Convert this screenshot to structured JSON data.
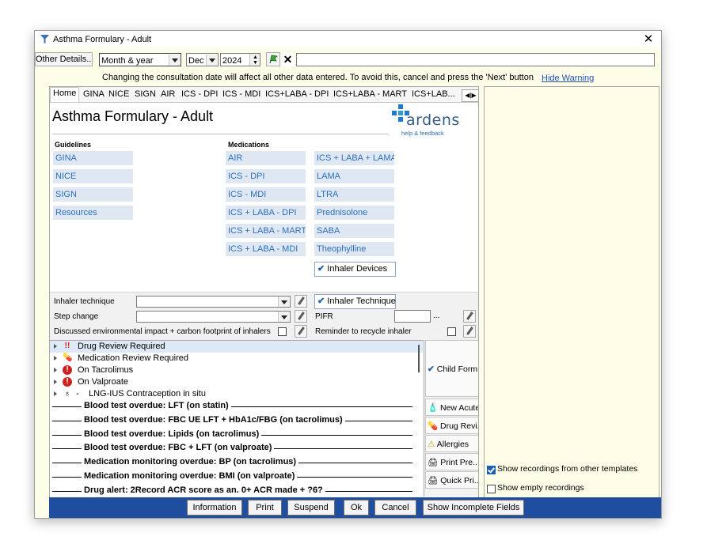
{
  "window": {
    "title": "Asthma Formulary - Adult",
    "close_icon": "close-icon"
  },
  "toolbar": {
    "other_details_label": "Other Details...",
    "period_selected": "Month & year",
    "month_selected": "Dec",
    "year_value": "2024",
    "accept_icon": "green-flag-icon",
    "clear_icon": "x-icon",
    "text_value": ""
  },
  "warning": {
    "text": "Changing the consultation date will affect all other data entered. To avoid this, cancel and press the 'Next' button",
    "hide_label": "Hide Warning"
  },
  "tabs": [
    "Home",
    "GINA",
    "NICE",
    "SIGN",
    "AIR",
    "ICS - DPI",
    "ICS - MDI",
    "ICS+LABA - DPI",
    "ICS+LABA - MART",
    "ICS+LAB..."
  ],
  "page": {
    "title": "Asthma Formulary - Adult"
  },
  "logo": {
    "name": "ardens",
    "help": "help & feedback"
  },
  "guidelines": {
    "label": "Guidelines",
    "items": [
      "GINA",
      "NICE",
      "SIGN",
      "Resources"
    ]
  },
  "medications": {
    "label": "Medications",
    "col1": [
      "AIR",
      "ICS - DPI",
      "ICS - MDI",
      "ICS + LABA - DPI",
      "ICS + LABA - MART",
      "ICS + LABA - MDI"
    ],
    "col2": [
      "ICS + LABA + LAMA",
      "LAMA",
      "LTRA",
      "Prednisolone",
      "SABA",
      "Theophylline"
    ],
    "inhaler_devices": "Inhaler Devices"
  },
  "fields": {
    "inhaler_technique": "Inhaler technique",
    "inhaler_technique_btn": "Inhaler Technique",
    "step_change": "Step change",
    "pifr": "PIFR",
    "pifr_ellipsis": "...",
    "environmental": "Discussed environmental impact + carbon footprint of inhalers",
    "recycle": "Reminder to recycle inhaler"
  },
  "alerts": [
    {
      "icon": "double-exclamation-icon",
      "text": "Drug Review Required"
    },
    {
      "icon": "pill-icon",
      "text": "Medication Review Required"
    },
    {
      "icon": "red-alert-icon",
      "text": "On Tacrolimus"
    },
    {
      "icon": "red-alert-icon",
      "text": "On Valproate"
    },
    {
      "icon": "lightbulb-icon",
      "text": "LNG-IUS Contraception in situ"
    }
  ],
  "alert_dash": "-",
  "bold_alerts": [
    "Blood test overdue: LFT (on statin)",
    "Blood test overdue: FBC UE LFT + HbA1c/FBG (on tacrolimus)",
    "Blood test overdue: Lipids (on tacrolimus)",
    "Blood test overdue: FBC + LFT (on valproate)",
    "Medication monitoring overdue: BP (on tacrolimus)",
    "Medication monitoring overdue: BMI (on valproate)",
    "Drug alert: 2Record ACR score as an. 0+ ACR made + ?6?"
  ],
  "side_buttons": [
    "Child Form",
    "New Acute",
    "Drug Revi...",
    "Allergies",
    "Print Pre...",
    "Quick Pri..."
  ],
  "right_panel": {
    "show_other": "Show recordings from other templates",
    "show_other_checked": true,
    "show_empty": "Show empty recordings",
    "show_empty_checked": false
  },
  "footer": [
    "Information",
    "Print",
    "Suspend",
    "Ok",
    "Cancel",
    "Show Incomplete Fields"
  ]
}
